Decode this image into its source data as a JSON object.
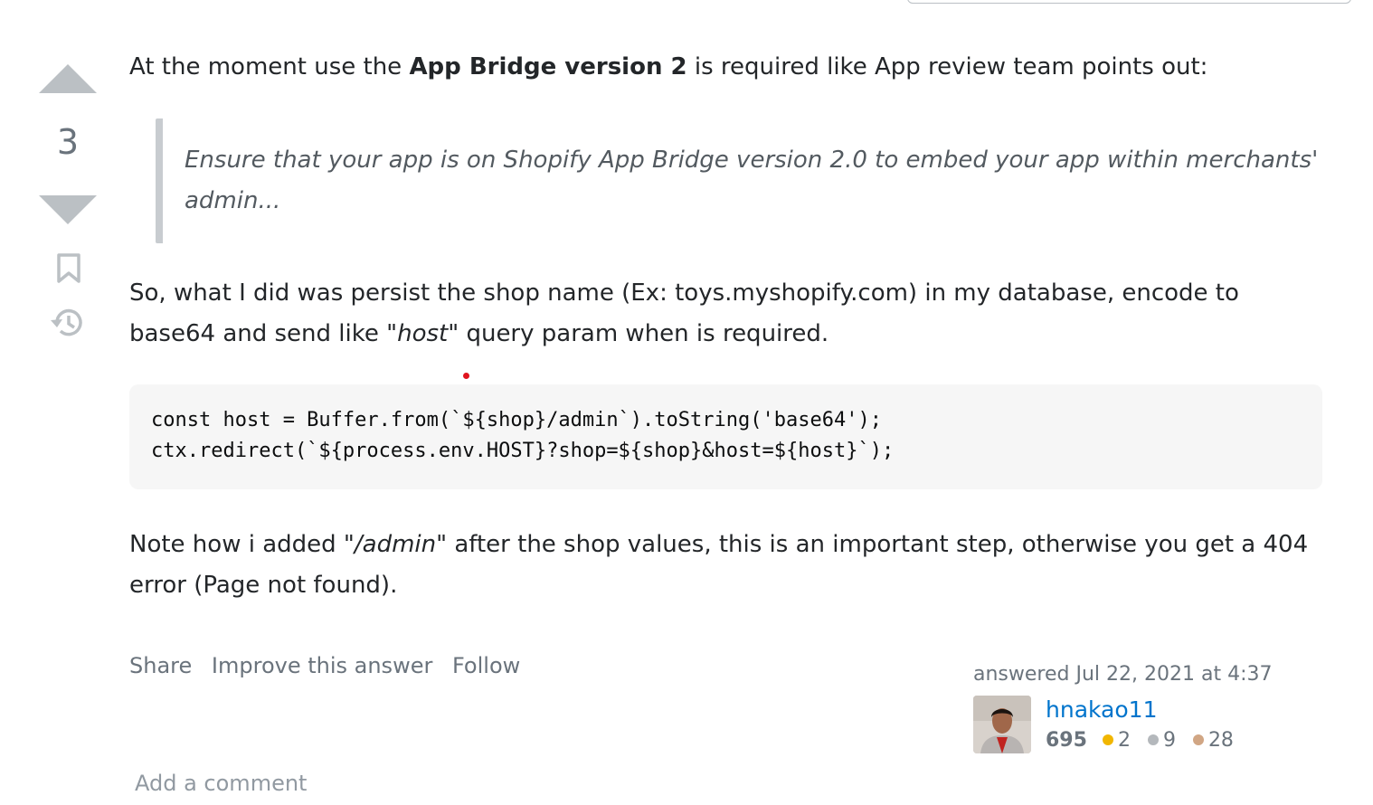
{
  "vote": {
    "count": "3"
  },
  "post": {
    "p1": {
      "before": "At the moment use the ",
      "bold": "App Bridge version 2",
      "after": " is required like App review team points out:"
    },
    "quote": "Ensure that your app is on Shopify App Bridge version 2.0 to embed your app within merchants' admin...",
    "p2": {
      "before": "So, what I did was persist the shop name (Ex: toys.myshopify.com) in my database, encode to base64 and send like \"",
      "em": "host",
      "after": "\" query param when is required."
    },
    "code": [
      "const host = Buffer.from(`${shop}/admin`).toString('base64');",
      "ctx.redirect(`${process.env.HOST}?shop=${shop}&host=${host}`);"
    ],
    "p3": {
      "before": "Note how i added \"",
      "em": "/admin",
      "after": "\" after the shop values, this is an important step, otherwise you get a 404 error (Page not found)."
    }
  },
  "menu": {
    "share": "Share",
    "improve": "Improve this answer",
    "follow": "Follow"
  },
  "user": {
    "answered": "answered Jul 22, 2021 at 4:37",
    "name": "hnakao11",
    "reputation": "695",
    "gold": "2",
    "silver": "9",
    "bronze": "28"
  },
  "comment": {
    "add": "Add a comment"
  },
  "colors": {
    "link": "#0074cc",
    "muted": "#6a737c",
    "vote_arrow": "#bbc0c4",
    "gold": "#f1b600",
    "silver": "#b4b8bc",
    "bronze": "#d1a684"
  }
}
